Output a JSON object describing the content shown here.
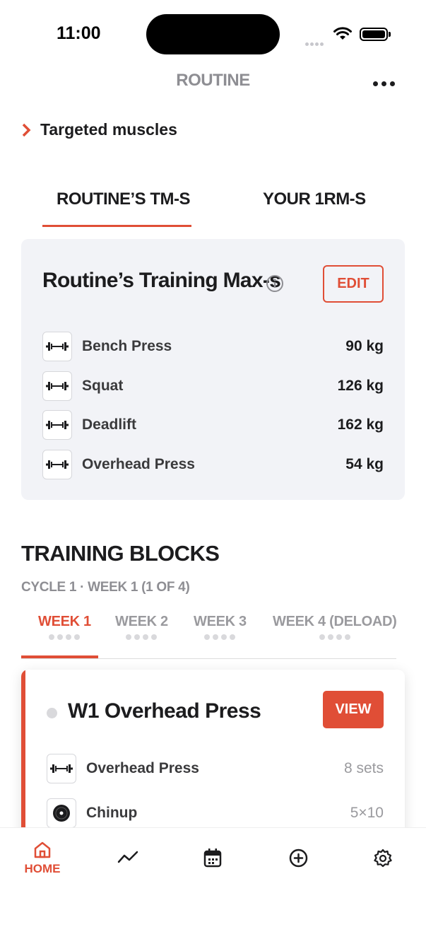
{
  "status_bar": {
    "time": "11:00"
  },
  "header": {
    "title": "ROUTINE"
  },
  "targeted_muscles": {
    "label": "Targeted muscles"
  },
  "tabs": [
    {
      "label": "ROUTINE’S TM-S",
      "active": true
    },
    {
      "label": "YOUR 1RM-S",
      "active": false
    }
  ],
  "tm_card": {
    "title": "Routine’s Training Max-s",
    "edit_label": "EDIT",
    "rows": [
      {
        "name": "Bench Press",
        "value": "90 kg",
        "icon": "barbell-icon"
      },
      {
        "name": "Squat",
        "value": "126 kg",
        "icon": "barbell-icon"
      },
      {
        "name": "Deadlift",
        "value": "162 kg",
        "icon": "barbell-icon"
      },
      {
        "name": "Overhead Press",
        "value": "54 kg",
        "icon": "barbell-icon"
      }
    ]
  },
  "training_blocks": {
    "title": "TRAINING BLOCKS",
    "subtitle": "CYCLE 1 · WEEK 1 (1 OF 4)",
    "weeks": [
      {
        "label": "WEEK 1",
        "active": true
      },
      {
        "label": "WEEK 2",
        "active": false
      },
      {
        "label": "WEEK 3",
        "active": false
      },
      {
        "label": "WEEK 4 (DELOAD)",
        "active": false
      }
    ]
  },
  "workout": {
    "title": "W1 Overhead Press",
    "view_label": "VIEW",
    "exercises": [
      {
        "name": "Overhead Press",
        "sets": "8 sets",
        "icon": "barbell-icon"
      },
      {
        "name": "Chinup",
        "sets": "5×10",
        "icon": "plate-icon"
      }
    ]
  },
  "tab_bar": {
    "items": [
      {
        "label": "HOME",
        "icon": "home-icon",
        "active": true
      },
      {
        "label": "",
        "icon": "trend-icon",
        "active": false
      },
      {
        "label": "",
        "icon": "calendar-icon",
        "active": false
      },
      {
        "label": "",
        "icon": "add-circle-icon",
        "active": false
      },
      {
        "label": "",
        "icon": "gear-icon",
        "active": false
      }
    ]
  },
  "colors": {
    "accent": "#e04e36",
    "card_bg": "#f2f3f7",
    "muted": "#8e8e93"
  }
}
